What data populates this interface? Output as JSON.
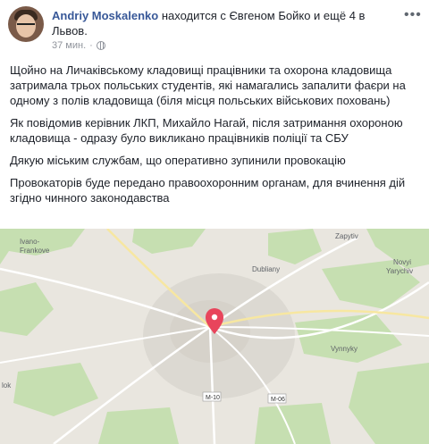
{
  "header": {
    "author": "Andriy Moskalenko",
    "with_text": "находится с Євгеном Бойко и ещё 4 в",
    "location": "Львов.",
    "time": "37 мин.",
    "more_icon": "ellipsis-icon",
    "privacy_icon": "globe-icon"
  },
  "body": {
    "paragraphs": [
      "Щойно на Личаківському кладовищі працівники та охорона кладовища затримала трьох польських студентів, які намагались запалити фаєри на одному з полів кладовища (біля місця польських військових поховань)",
      "Як повідомив керівник ЛКП, Михайло Нагай, після затримання охороною кладовища - одразу було викликано працівників поліції та СБУ",
      "Дякую міським службам, що оперативно зупинили провокацію",
      "Провокаторів буде передано правоохоронним органам, для вчинення дій згідно чинного законодавства"
    ]
  },
  "map": {
    "labels": {
      "ivano": "Ivano-",
      "frankove": "Frankove",
      "dubliany": "Dubliany",
      "zapytiv": "Zapytiv",
      "novyi": "Novyi",
      "yarychiv": "Yarychiv",
      "vynnyky": "Vynnyky",
      "lok": "lok"
    },
    "roads": {
      "m10": "M-10",
      "m06": "M-06"
    },
    "pin_icon": "map-pin-icon",
    "colors": {
      "land": "#e9e6df",
      "forest": "#c6dfb1",
      "city": "#dcd9d2",
      "pin": "#e8455c"
    }
  }
}
